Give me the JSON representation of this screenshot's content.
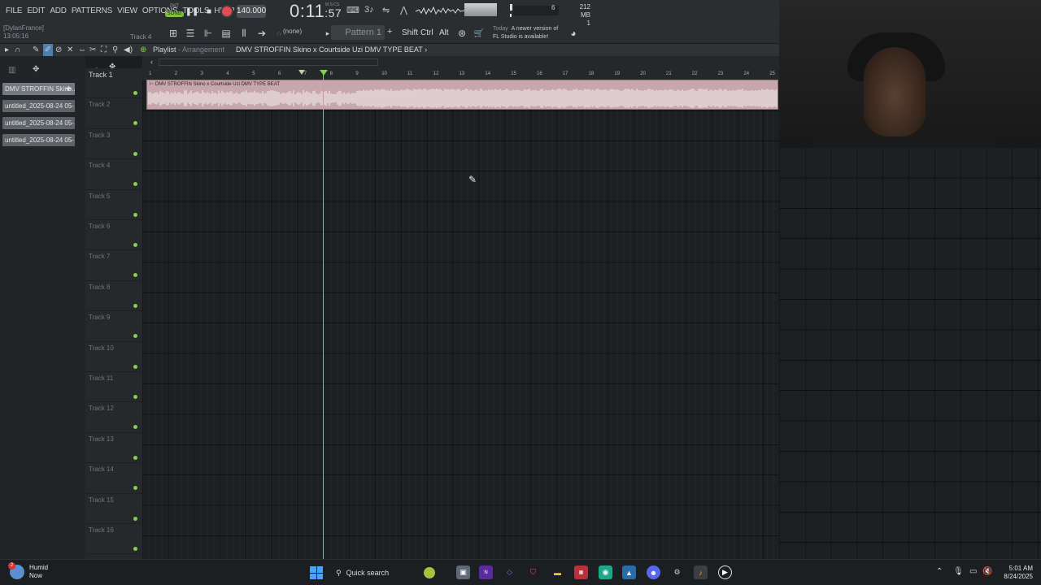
{
  "menu": [
    "FILE",
    "EDIT",
    "ADD",
    "PATTERNS",
    "VIEW",
    "OPTIONS",
    "TOOLS",
    "HELP"
  ],
  "hint": {
    "user": "[DylanFrance]",
    "time": "13:05:16",
    "track": "Track 4"
  },
  "transport": {
    "pat_label": "PAT",
    "song_label": "SONG",
    "tempo": "140.000",
    "time_main": "0:11",
    "time_sub": ":57",
    "time_units": "M:S:CS",
    "cpu_value": "6",
    "memory": "212 MB",
    "poly": "1"
  },
  "toolbar2": {
    "pattern_selector": "(none)",
    "pattern": "Pattern 1",
    "plus": "+",
    "mods": [
      "Shift",
      "Ctrl",
      "Alt"
    ],
    "news_today": "Today",
    "news_line1": "A newer version of",
    "news_line2": "FL Studio is available!"
  },
  "playlist": {
    "title": "Playlist",
    "title_sub": "- Arrangement",
    "song": "DMV STROFFIN Skino x Courtside Uzi DMV TYPE BEAT",
    "song_arrow": "›",
    "clip_caption": "⊢ DMV STROFFIN Skino x Courtside Uzi DMV TYPE BEAT"
  },
  "picker": {
    "clips": [
      "DMV STROFFIN Skino...",
      "untitled_2025-08-24 05-...",
      "untitled_2025-08-24 05-...",
      "untitled_2025-08-24 05-..."
    ]
  },
  "tracks": [
    "Track 1",
    "Track 2",
    "Track 3",
    "Track 4",
    "Track 5",
    "Track 6",
    "Track 7",
    "Track 8",
    "Track 9",
    "Track 10",
    "Track 11",
    "Track 12",
    "Track 13",
    "Track 14",
    "Track 15",
    "Track 16"
  ],
  "ruler": [
    "1",
    "2",
    "3",
    "4",
    "5",
    "6",
    "7",
    "8",
    "9",
    "10",
    "11",
    "12",
    "13",
    "14",
    "15",
    "16",
    "17",
    "18",
    "19",
    "20",
    "21",
    "22",
    "23",
    "24",
    "25"
  ],
  "taskbar": {
    "weather_badge": "2",
    "weather_title": "Humid",
    "weather_sub": "Now",
    "search": "Quick search",
    "clock_time": "5:01 AM",
    "clock_date": "8/24/2025"
  },
  "colors": {
    "accent_green": "#7fd24b",
    "clip_pink": "#c7a7ad",
    "record_red": "#e24a55"
  }
}
